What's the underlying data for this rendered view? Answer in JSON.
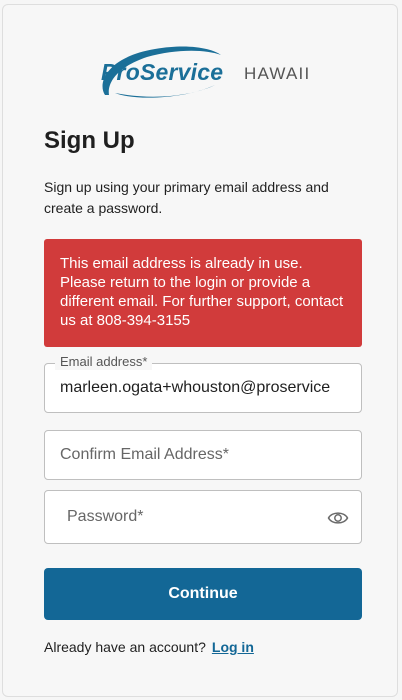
{
  "logo": {
    "brand": "ProService",
    "region": "HAWAII"
  },
  "page": {
    "title": "Sign Up",
    "subtitle": "Sign up using your primary email address and create a password."
  },
  "alert": {
    "message": "This email address is already in use. Please return to the login or provide a different email. For further support, contact us at 808-394-3155"
  },
  "form": {
    "email": {
      "label": "Email address*",
      "value": "marleen.ogata+whouston@proservice"
    },
    "confirm_email": {
      "placeholder": "Confirm Email Address*"
    },
    "password": {
      "placeholder": "Password*"
    },
    "continue_label": "Continue"
  },
  "footer": {
    "prompt": "Already have an account?",
    "login_link": "Log in"
  },
  "colors": {
    "brand": "#136796",
    "error": "#d13b3b"
  },
  "icons": {
    "password_toggle": "eye-icon"
  }
}
